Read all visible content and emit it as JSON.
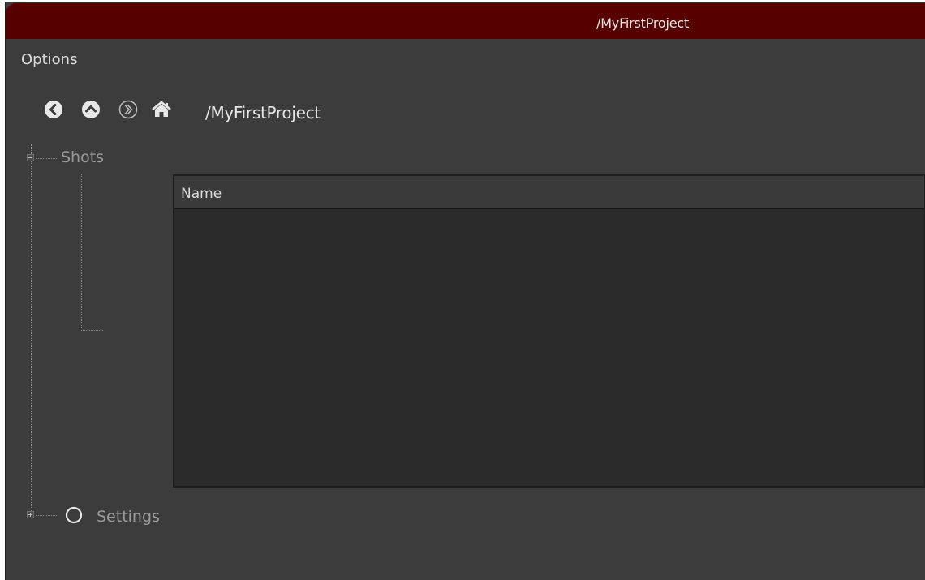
{
  "window": {
    "title": "/MyFirstProject",
    "titlebar_color": "#570000",
    "background_color": "#3c3c3c"
  },
  "menubar": {
    "items": [
      {
        "label": "Options"
      }
    ]
  },
  "navigation": {
    "buttons": [
      {
        "name": "back",
        "icon": "chevron-left-circle-icon"
      },
      {
        "name": "up",
        "icon": "chevron-up-circle-icon"
      },
      {
        "name": "forward",
        "icon": "double-chevron-right-circle-icon"
      },
      {
        "name": "home",
        "icon": "home-icon"
      }
    ],
    "current_path": "/MyFirstProject"
  },
  "tree": {
    "nodes": [
      {
        "label": "Shots",
        "expanded": true,
        "expander_icon": "minus-box-icon"
      },
      {
        "label": "Settings",
        "expanded": false,
        "expander_icon": "plus-box-icon",
        "status_icon": "circle-outline-icon"
      }
    ]
  },
  "shots_list": {
    "columns": [
      "Name"
    ],
    "rows": []
  }
}
